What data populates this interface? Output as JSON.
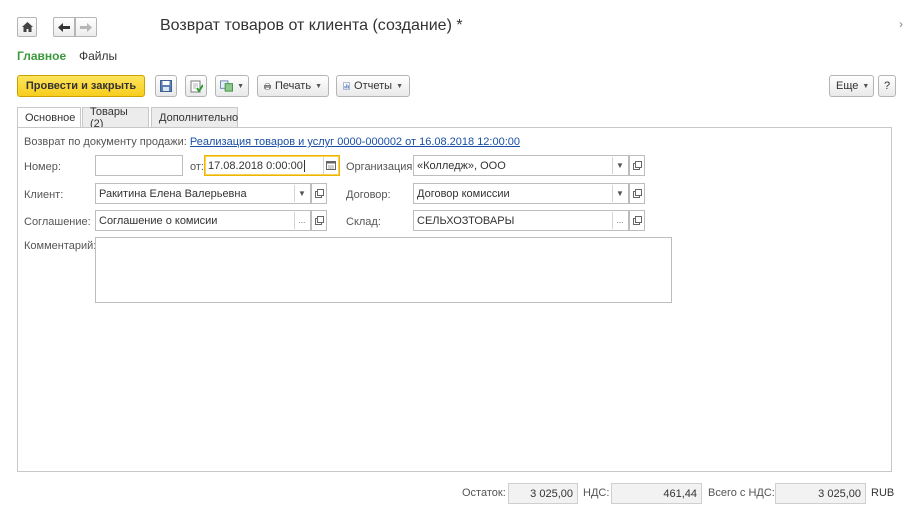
{
  "header": {
    "title": "Возврат товаров от клиента (создание) *"
  },
  "sections": {
    "main": "Главное",
    "files": "Файлы"
  },
  "toolbar": {
    "post_close": "Провести и закрыть",
    "print": "Печать",
    "reports": "Отчеты",
    "more": "Еще",
    "help": "?"
  },
  "tabs": [
    {
      "label": "Основное"
    },
    {
      "label": "Товары (2)"
    },
    {
      "label": "Дополнительно"
    }
  ],
  "form": {
    "basis_label": "Возврат по документу продажи:",
    "basis_link": "Реализация товаров и услуг 0000-000002 от 16.08.2018 12:00:00",
    "number_label": "Номер:",
    "number_value": "",
    "date_label": "от:",
    "date_value": "17.08.2018  0:00:00",
    "org_label": "Организация:",
    "org_value": "«Колледж», ООО",
    "client_label": "Клиент:",
    "client_value": "Ракитина Елена Валерьевна",
    "contract_label": "Договор:",
    "contract_value": "Договор комиссии",
    "agreement_label": "Соглашение:",
    "agreement_value": "Соглашение о комисии",
    "warehouse_label": "Склад:",
    "warehouse_value": "СЕЛЬХОЗТОВАРЫ",
    "comment_label": "Комментарий:",
    "comment_value": ""
  },
  "totals": {
    "balance_label": "Остаток:",
    "balance_value": "3 025,00",
    "vat_label": "НДС:",
    "vat_value": "461,44",
    "total_label": "Всего с НДС:",
    "total_value": "3 025,00",
    "currency": "RUB"
  },
  "colors": {
    "primary_button": "#f7cd1d",
    "section_active": "#3b9a3b",
    "link": "#1a4fa5",
    "date_focus": "#f0b400"
  }
}
